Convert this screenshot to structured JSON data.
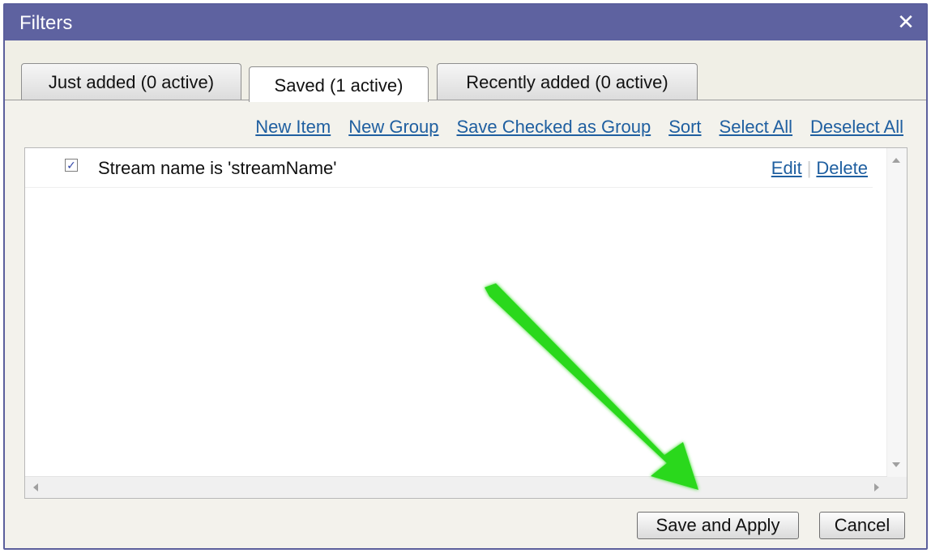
{
  "dialog": {
    "title": "Filters",
    "close_glyph": "✕"
  },
  "tabs": [
    {
      "label": "Just added (0 active)",
      "active": false
    },
    {
      "label": "Saved (1 active)",
      "active": true
    },
    {
      "label": "Recently added (0 active)",
      "active": false
    }
  ],
  "toolbar": {
    "new_item": "New Item",
    "new_group": "New Group",
    "save_checked": "Save Checked as Group",
    "sort": "Sort",
    "select_all": "Select All",
    "deselect_all": "Deselect All"
  },
  "list": {
    "items": [
      {
        "checked": true,
        "check_glyph": "✓",
        "label": "Stream name is 'streamName'",
        "edit": "Edit",
        "separator": "|",
        "delete": "Delete"
      }
    ]
  },
  "footer": {
    "save_apply": "Save and Apply",
    "cancel": "Cancel"
  },
  "colors": {
    "titlebar": "#5e62a0",
    "link": "#1f5fa0",
    "annotation_arrow": "#2bd81c"
  },
  "icons": {
    "close": "close-icon",
    "checkbox": "checkbox-checked-icon",
    "scroll_up": "arrow-up-icon",
    "scroll_down": "arrow-down-icon",
    "scroll_left": "arrow-left-icon",
    "scroll_right": "arrow-right-icon",
    "annotation": "green-arrow-icon"
  }
}
